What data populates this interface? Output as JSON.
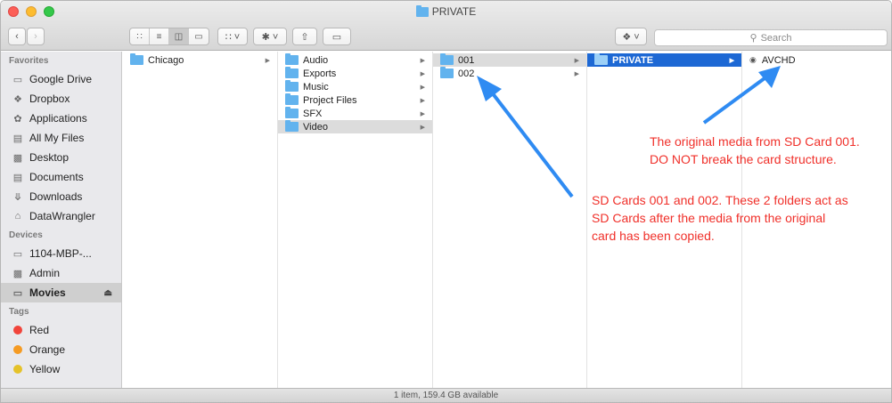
{
  "window": {
    "title": "PRIVATE"
  },
  "toolbar": {
    "search_placeholder": "Search",
    "view_icons": [
      "icon-view-icon",
      "list-view-icon",
      "column-view-icon",
      "cover-flow-icon"
    ]
  },
  "sidebar": {
    "favorites_header": "Favorites",
    "favorites": [
      {
        "label": "Google Drive",
        "icon": "folder-icon"
      },
      {
        "label": "Dropbox",
        "icon": "dropbox-icon"
      },
      {
        "label": "Applications",
        "icon": "applications-icon"
      },
      {
        "label": "All My Files",
        "icon": "all-files-icon"
      },
      {
        "label": "Desktop",
        "icon": "desktop-icon"
      },
      {
        "label": "Documents",
        "icon": "documents-icon"
      },
      {
        "label": "Downloads",
        "icon": "downloads-icon"
      },
      {
        "label": "DataWrangler",
        "icon": "home-icon"
      }
    ],
    "devices_header": "Devices",
    "devices": [
      {
        "label": "1104-MBP-...",
        "icon": "laptop-icon"
      },
      {
        "label": "Admin",
        "icon": "disk-icon"
      },
      {
        "label": "Movies",
        "icon": "drive-icon",
        "selected": true
      }
    ],
    "tags_header": "Tags",
    "tags": [
      {
        "label": "Red",
        "color": "#f1443b"
      },
      {
        "label": "Orange",
        "color": "#f59b23"
      },
      {
        "label": "Yellow",
        "color": "#e5c22a"
      }
    ]
  },
  "columns": [
    {
      "items": [
        {
          "label": "Chicago",
          "arrow": true,
          "state": ""
        }
      ]
    },
    {
      "items": [
        {
          "label": "Audio",
          "arrow": true,
          "state": ""
        },
        {
          "label": "Exports",
          "arrow": true,
          "state": ""
        },
        {
          "label": "Music",
          "arrow": true,
          "state": ""
        },
        {
          "label": "Project Files",
          "arrow": true,
          "state": ""
        },
        {
          "label": "SFX",
          "arrow": true,
          "state": ""
        },
        {
          "label": "Video",
          "arrow": true,
          "state": "hl"
        }
      ]
    },
    {
      "items": [
        {
          "label": "001",
          "arrow": true,
          "state": "hl"
        },
        {
          "label": "002",
          "arrow": true,
          "state": ""
        }
      ]
    },
    {
      "items": [
        {
          "label": "PRIVATE",
          "arrow": true,
          "state": "sel"
        }
      ]
    },
    {
      "items": [
        {
          "label": "AVCHD",
          "arrow": false,
          "state": "file"
        }
      ]
    }
  ],
  "status": "1 item, 159.4 GB available",
  "annotations": {
    "note1_line1": "The original media from SD Card 001.",
    "note1_line2": "DO NOT break the card structure.",
    "note2_line1": "SD Cards 001 and 002. These 2 folders act as",
    "note2_line2": "SD Cards after the media from the original",
    "note2_line3": "card has been copied.",
    "color": "#f0302a",
    "arrow_color": "#2f8bf2"
  }
}
